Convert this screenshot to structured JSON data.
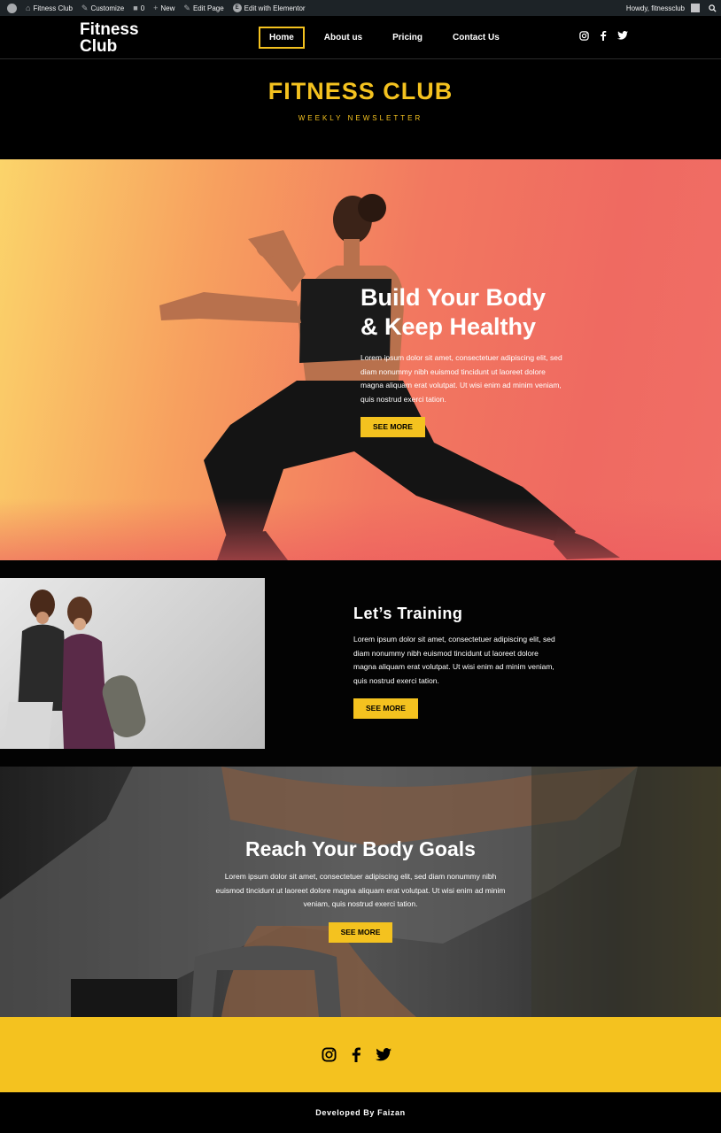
{
  "adminbar": {
    "site": "Fitness Club",
    "customize": "Customize",
    "comments": "0",
    "new": "New",
    "edit_page": "Edit Page",
    "edit_elementor": "Edit with Elementor",
    "howdy": "Howdy, fitnessclub"
  },
  "header": {
    "logo": "Fitness Club",
    "nav": [
      "Home",
      "About us",
      "Pricing",
      "Contact Us"
    ],
    "active_nav": "Home",
    "social_icons": [
      "instagram-icon",
      "facebook-icon",
      "twitter-icon"
    ]
  },
  "hero": {
    "title": "FITNESS CLUB",
    "subtitle": "WEEKLY NEWSLETTER"
  },
  "section1": {
    "heading": "Build Your Body & Keep Healthy",
    "text": "Lorem ipsum dolor sit amet, consectetuer adipiscing elit, sed diam nonummy nibh euismod tincidunt ut laoreet dolore magna aliquam erat volutpat. Ut wisi enim ad minim veniam, quis nostrud exerci tation.",
    "button": "SEE MORE"
  },
  "section2": {
    "heading": "Let’s Training",
    "text": "Lorem ipsum dolor sit amet, consectetuer adipiscing elit, sed diam nonummy nibh euismod tincidunt ut laoreet dolore magna aliquam erat volutpat. Ut wisi enim ad minim veniam, quis nostrud exerci tation.",
    "button": "SEE MORE"
  },
  "section3": {
    "heading": "Reach Your Body Goals",
    "text": "Lorem ipsum dolor sit amet, consectetuer adipiscing elit, sed diam nonummy nibh euismod tincidunt ut laoreet dolore magna aliquam erat volutpat. Ut wisi enim ad minim veniam, quis nostrud exerci tation.",
    "button": "SEE MORE"
  },
  "footer": {
    "social_icons": [
      "instagram-icon",
      "facebook-icon",
      "twitter-icon"
    ],
    "credit": "Developed By Faizan"
  },
  "colors": {
    "accent": "#f4c21f",
    "background": "#000000",
    "adminbar": "#1d2327"
  }
}
